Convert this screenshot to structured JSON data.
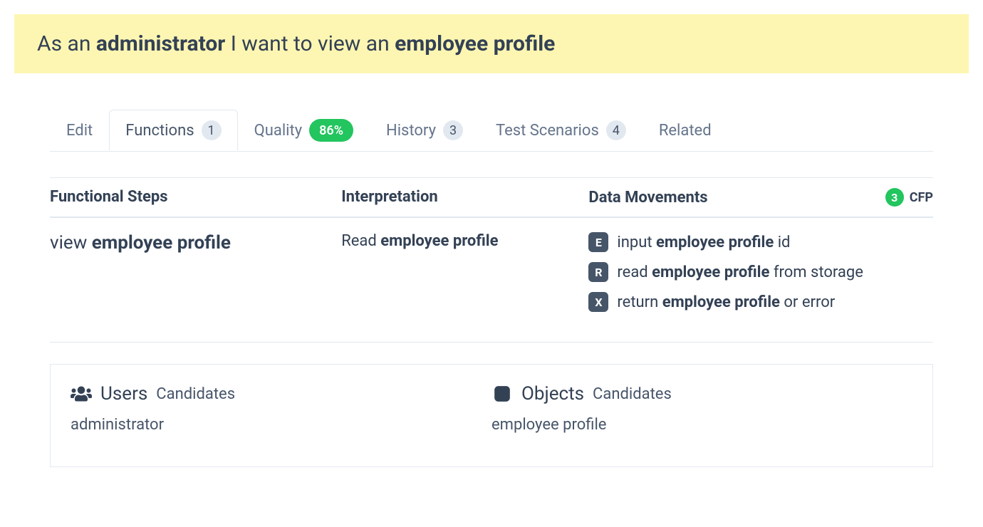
{
  "hero": {
    "prefix": "As an ",
    "role": "administrator",
    "middle": " I want to view an ",
    "object": "employee profile"
  },
  "tabs": {
    "edit": "Edit",
    "functions": {
      "label": "Functions",
      "count": "1"
    },
    "quality": {
      "label": "Quality",
      "pct": "86%"
    },
    "history": {
      "label": "History",
      "count": "3"
    },
    "scenarios": {
      "label": "Test Scenarios",
      "count": "4"
    },
    "related": "Related"
  },
  "headers": {
    "steps": "Functional Steps",
    "interp": "Interpretation",
    "movements": "Data Movements",
    "cfp_count": "3",
    "cfp_label": "CFP"
  },
  "step": {
    "prefix": "view ",
    "bold": "employee profile"
  },
  "interp": {
    "prefix": "Read ",
    "bold": "employee profile"
  },
  "movements": {
    "m0": {
      "code": "E",
      "pre": "input ",
      "bold": "employee profile",
      "post": " id"
    },
    "m1": {
      "code": "R",
      "pre": "read ",
      "bold": "employee profile",
      "post": " from storage"
    },
    "m2": {
      "code": "X",
      "pre": "return ",
      "bold": "employee profile",
      "post": " or error"
    }
  },
  "candidates": {
    "users": {
      "title": "Users",
      "sub": "Candidates",
      "value": "administrator"
    },
    "objects": {
      "title": "Objects",
      "sub": "Candidates",
      "value": "employee profile"
    }
  }
}
